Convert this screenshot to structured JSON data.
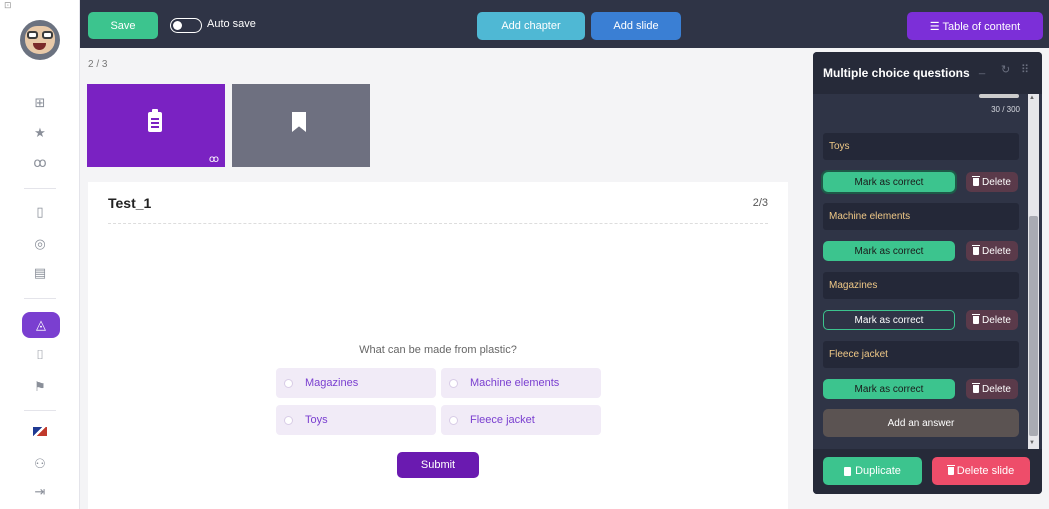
{
  "topbar": {
    "save_label": "Save",
    "autosave_label": "Auto save",
    "add_chapter_label": "Add chapter",
    "add_slide_label": "Add slide",
    "toc_label": "☰ Table of content"
  },
  "content": {
    "page_indicator": "2 / 3",
    "card_title": "Test_1",
    "card_counter": "2/3",
    "question": "What can be made from plastic?",
    "answers": [
      "Magazines",
      "Machine elements",
      "Toys",
      "Fleece jacket"
    ],
    "submit_label": "Submit"
  },
  "panel": {
    "title": "Multiple choice questions",
    "char_count": "30 / 300",
    "answers": [
      {
        "text": "Toys",
        "mark_label": "Mark as correct",
        "delete_label": "Delete"
      },
      {
        "text": "Machine elements",
        "mark_label": "Mark as correct",
        "delete_label": "Delete"
      },
      {
        "text": "Magazines",
        "mark_label": "Mark as correct",
        "delete_label": "Delete"
      },
      {
        "text": "Fleece jacket",
        "mark_label": "Mark as correct",
        "delete_label": "Delete"
      }
    ],
    "add_answer_label": "Add an answer",
    "duplicate_label": "Duplicate",
    "delete_slide_label": "Delete slide"
  },
  "colors": {
    "accent_purple": "#7a22c2",
    "green": "#3cc48e",
    "dark_bar": "#2f3446",
    "delete_red": "#ee4d6a"
  },
  "icons": [
    "dashboard-icon",
    "star-icon",
    "binoculars-icon",
    "document-icon",
    "lifebuoy-icon",
    "book-icon",
    "graduation-cap-icon",
    "exit-door-icon",
    "podium-icon",
    "uk-flag-icon",
    "user-settings-icon",
    "logout-icon",
    "clipboard-icon",
    "bookmark-icon"
  ]
}
